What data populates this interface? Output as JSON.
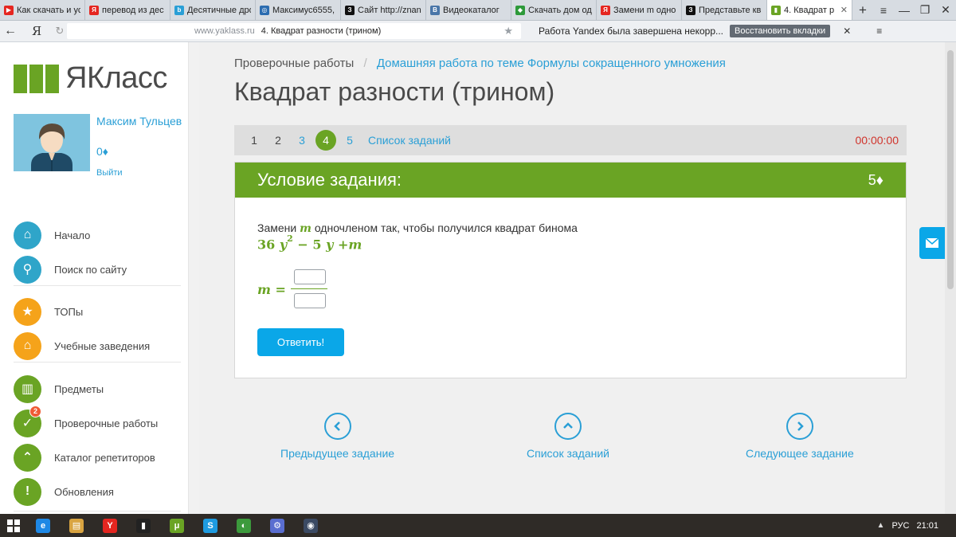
{
  "browser": {
    "tabs": [
      {
        "title": "Как скачать и ус",
        "favicon_color": "#e52620",
        "favicon_glyph": "▶",
        "active": false
      },
      {
        "title": "перевод из дес",
        "favicon_color": "#e52620",
        "favicon_glyph": "Я",
        "active": false
      },
      {
        "title": "Десятичные дро",
        "favicon_color": "#2a9fd6",
        "favicon_glyph": "b",
        "active": false
      },
      {
        "title": "Максимус6555,",
        "favicon_color": "#2b6cb0",
        "favicon_glyph": "◎",
        "active": false
      },
      {
        "title": "Сайт http://znan",
        "favicon_color": "#111111",
        "favicon_glyph": "З",
        "active": false
      },
      {
        "title": "Видеокаталог",
        "favicon_color": "#4a76a8",
        "favicon_glyph": "В",
        "active": false
      },
      {
        "title": "Скачать дом од",
        "favicon_color": "#2e9a3a",
        "favicon_glyph": "◆",
        "active": false
      },
      {
        "title": "Замени m одно",
        "favicon_color": "#e52620",
        "favicon_glyph": "Я",
        "active": false
      },
      {
        "title": "Представьте кв",
        "favicon_color": "#111111",
        "favicon_glyph": "З",
        "active": false
      },
      {
        "title": "4. Квадрат р",
        "favicon_color": "#6aa424",
        "favicon_glyph": "▮",
        "active": true
      }
    ],
    "new_tab_icon": "+",
    "window_controls": [
      "≡",
      "—",
      "❐",
      "✕"
    ],
    "back_icon": "←",
    "yandex_logo": "Я",
    "reload_icon": "↻",
    "url_domain": "www.yaklass.ru",
    "page_title": "4. Квадрат разности (трином)",
    "bookmark_icon": "★",
    "crash_message": "Работа Yandex была завершена некорр...",
    "restore_label": "Восстановить вкладки",
    "crash_close": "✕",
    "menu_icon": "≡"
  },
  "sidebar": {
    "logo_text": "ЯКласс",
    "user_name": "Максим Тульцев",
    "user_points": "0♦",
    "logout_label": "Выйти",
    "items": [
      {
        "label": "Начало",
        "icon": "home-icon",
        "glyph": "⌂",
        "color": "#2fa5c9"
      },
      {
        "label": "Поиск по сайту",
        "icon": "search-icon",
        "glyph": "⚲",
        "color": "#2fa5c9"
      },
      {
        "label": "ТОПы",
        "icon": "star-icon",
        "glyph": "★",
        "color": "#f5a31a"
      },
      {
        "label": "Учебные заведения",
        "icon": "building-icon",
        "glyph": "⌂",
        "color": "#f5a31a"
      },
      {
        "label": "Предметы",
        "icon": "book-icon",
        "glyph": "▥",
        "color": "#6aa424"
      },
      {
        "label": "Проверочные работы",
        "icon": "check-icon",
        "glyph": "✓",
        "color": "#6aa424",
        "badge": "2"
      },
      {
        "label": "Каталог репетиторов",
        "icon": "graduation-cap-icon",
        "glyph": "⌃",
        "color": "#6aa424"
      },
      {
        "label": "Обновления",
        "icon": "exclamation-icon",
        "glyph": "!",
        "color": "#6aa424"
      }
    ]
  },
  "main": {
    "breadcrumb_root": "Проверочные работы",
    "breadcrumb_sep": "/",
    "breadcrumb_current": "Домашняя работа по теме Формулы сокращенного умножения",
    "title": "Квадрат разности (трином)",
    "task_numbers": [
      "1",
      "2",
      "3",
      "4",
      "5"
    ],
    "current_task": "4",
    "task_list_link": "Список заданий",
    "timer": "00:00:00",
    "task_header": "Условие задания:",
    "task_points": "5♦",
    "task_text_before": "Замени",
    "task_var": "m",
    "task_text_after": "одночленом так, чтобы получился квадрат бинома",
    "expr": {
      "coef": "36",
      "var1": "y",
      "exp": "2",
      "op1": "−",
      "coef2": "5",
      "var2": "y",
      "op2": "+",
      "var3": "m"
    },
    "answer_var": "m",
    "answer_eq": "=",
    "submit_label": "Ответить!",
    "bottom_nav": {
      "prev_label": "Предыдущее задание",
      "list_label": "Список заданий",
      "next_label": "Следующее задание"
    }
  },
  "taskbar": {
    "apps": [
      {
        "icon": "ie-icon",
        "glyph": "e",
        "color": "#1e88e5"
      },
      {
        "icon": "file-explorer-icon",
        "glyph": "▤",
        "color": "#d9a441"
      },
      {
        "icon": "yandex-browser-icon",
        "glyph": "Y",
        "color": "#e52620"
      },
      {
        "icon": "phone-icon",
        "glyph": "▮",
        "color": "#222222"
      },
      {
        "icon": "torrent-icon",
        "glyph": "μ",
        "color": "#6aa424"
      },
      {
        "icon": "skype-icon",
        "glyph": "S",
        "color": "#1e9be0"
      },
      {
        "icon": "utorrent-green-icon",
        "glyph": "◐",
        "color": "#3c9a3c"
      },
      {
        "icon": "network-tool-icon",
        "glyph": "⚙",
        "color": "#5a6ed0"
      },
      {
        "icon": "steam-icon",
        "glyph": "◉",
        "color": "#3b4a63"
      }
    ],
    "tray_arrow": "▲",
    "language": "РУС",
    "time": "21:01"
  }
}
